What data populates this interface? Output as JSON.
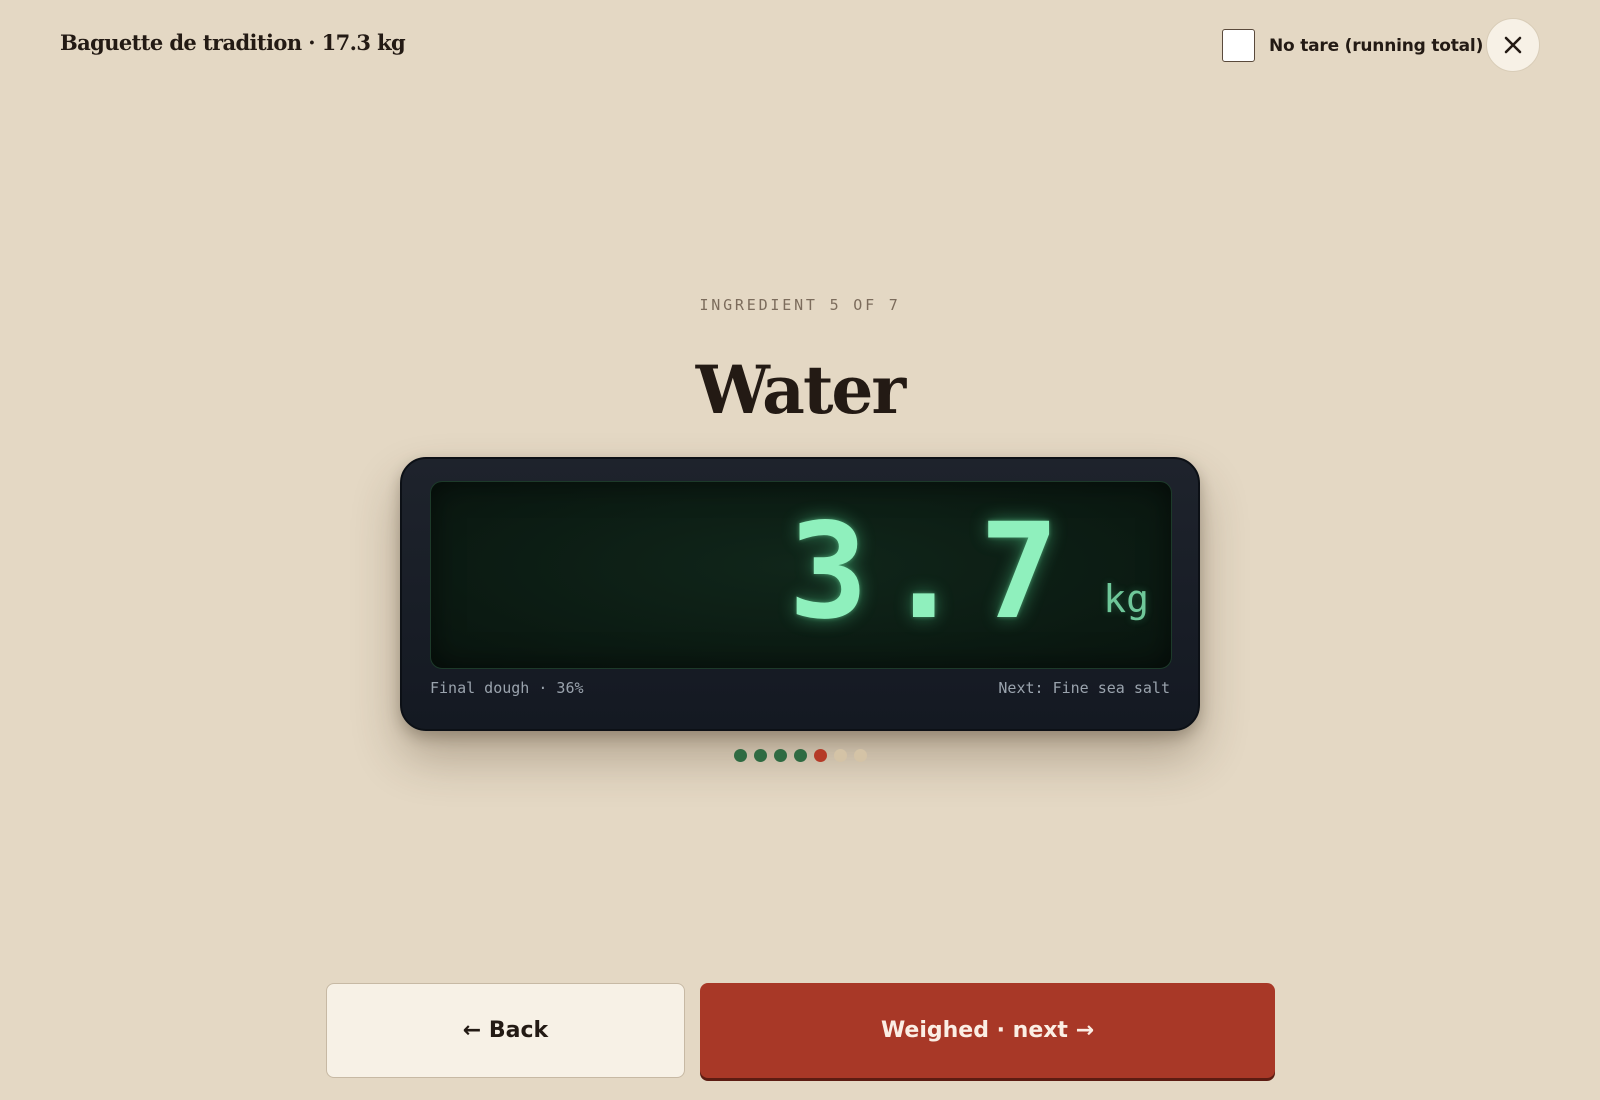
{
  "header": {
    "recipe_title": "Baguette de tradition · 17.3 kg",
    "tare_label": "No tare (running total)",
    "tare_checked": false,
    "close_icon": "close-icon"
  },
  "step": {
    "label": "INGREDIENT 5 OF 7",
    "current": 5,
    "total": 7,
    "ingredient": "Water"
  },
  "scale": {
    "reading": "3.7",
    "unit": "kg",
    "stage": "Final dough · 36%",
    "next": "Next: Fine sea salt"
  },
  "progress": {
    "dots": [
      "done",
      "done",
      "done",
      "done",
      "current",
      "pending",
      "pending"
    ],
    "colors": {
      "done": "#2f6b42",
      "current": "#b53a27",
      "pending": "#d4c3a6"
    }
  },
  "actions": {
    "back_label": "← Back",
    "next_label": "Weighed · next →"
  },
  "theme": {
    "background": "#e4d8c4",
    "accent": "#a83827",
    "display_green": "#8ff0bd"
  }
}
